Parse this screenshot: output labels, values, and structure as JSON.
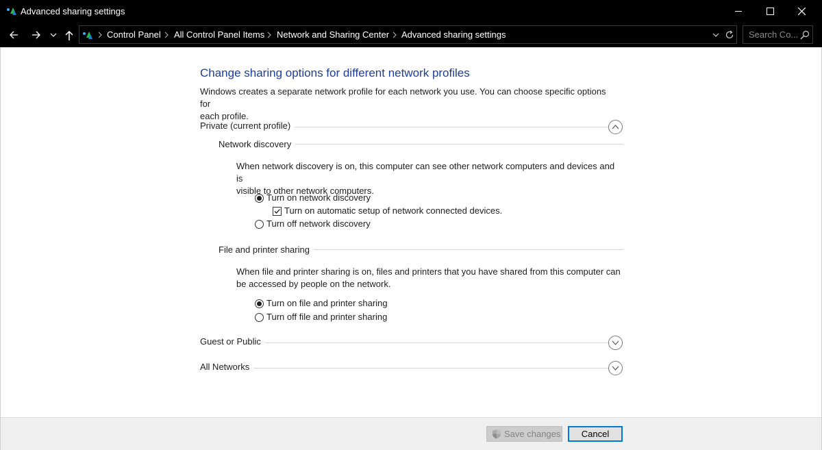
{
  "window": {
    "title": "Advanced sharing settings",
    "controls": [
      "minimize",
      "maximize",
      "close"
    ]
  },
  "address_bar": {
    "breadcrumbs": [
      "Control Panel",
      "All Control Panel Items",
      "Network and Sharing Center",
      "Advanced sharing settings"
    ],
    "search_placeholder": "Search Co..."
  },
  "main": {
    "heading": "Change sharing options for different network profiles",
    "intro_line1": "Windows creates a separate network profile for each network you use. You can choose specific options for",
    "intro_line2": "each profile.",
    "profiles": {
      "private": {
        "label": "Private (current profile)",
        "expanded": true,
        "network_discovery": {
          "label": "Network discovery",
          "desc_line1": "When network discovery is on, this computer can see other network computers and devices and is",
          "desc_line2": "visible to other network computers.",
          "option_on": "Turn on network discovery",
          "option_on_selected": true,
          "auto_setup": "Turn on automatic setup of network connected devices.",
          "auto_setup_checked": true,
          "option_off": "Turn off network discovery"
        },
        "file_printer_sharing": {
          "label": "File and printer sharing",
          "desc_line1": "When file and printer sharing is on, files and printers that you have shared from this computer can",
          "desc_line2": "be accessed by people on the network.",
          "option_on": "Turn on file and printer sharing",
          "option_on_selected": true,
          "option_off": "Turn off file and printer sharing"
        }
      },
      "guest": {
        "label": "Guest or Public",
        "expanded": false
      },
      "all": {
        "label": "All Networks",
        "expanded": false
      }
    }
  },
  "footer": {
    "save_label": "Save changes",
    "save_enabled": false,
    "cancel_label": "Cancel"
  },
  "colors": {
    "titlebar_bg": "#000000",
    "heading": "#1e3d9b",
    "focus_border": "#0078d7"
  }
}
